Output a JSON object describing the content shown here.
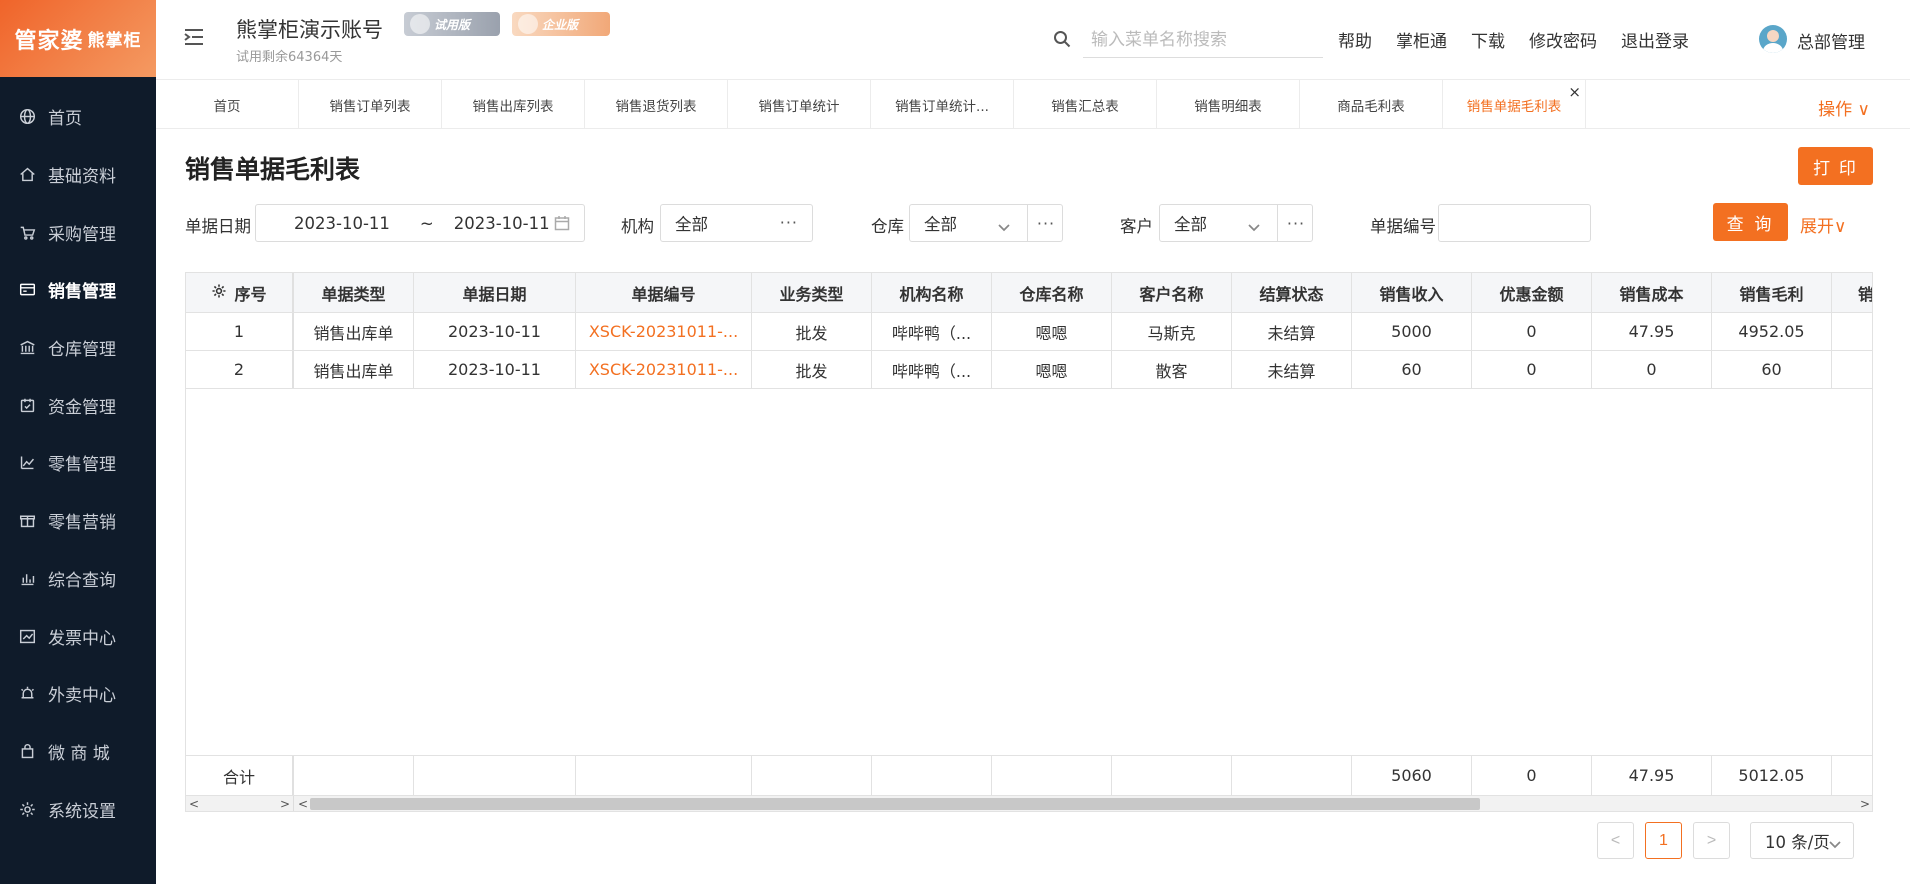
{
  "brand": {
    "logo_main": "管家婆",
    "logo_sub": "熊掌柜"
  },
  "sidebar": {
    "items": [
      {
        "label": "首页",
        "icon": "globe-icon"
      },
      {
        "label": "基础资料",
        "icon": "home-icon"
      },
      {
        "label": "采购管理",
        "icon": "cart-icon"
      },
      {
        "label": "销售管理",
        "icon": "card-icon",
        "active": true
      },
      {
        "label": "仓库管理",
        "icon": "bank-icon"
      },
      {
        "label": "资金管理",
        "icon": "calendar-icon"
      },
      {
        "label": "零售管理",
        "icon": "chart-icon"
      },
      {
        "label": "零售营销",
        "icon": "gift-icon"
      },
      {
        "label": "综合查询",
        "icon": "bar-chart-icon"
      },
      {
        "label": "发票中心",
        "icon": "trend-icon"
      },
      {
        "label": "外卖中心",
        "icon": "alarm-icon"
      },
      {
        "label": "微 商 城",
        "icon": "bag-icon"
      },
      {
        "label": "系统设置",
        "icon": "gear-icon"
      }
    ]
  },
  "header": {
    "account": "熊掌柜演示账号",
    "badge_trial": "试用版",
    "badge_enterprise": "企业版",
    "trial_text": "试用剩余64364天",
    "search_placeholder": "输入菜单名称搜索",
    "links": [
      "帮助",
      "掌柜通",
      "下载",
      "修改密码",
      "退出登录"
    ],
    "user_name": "总部管理"
  },
  "tabs": [
    {
      "label": "首页"
    },
    {
      "label": "销售订单列表"
    },
    {
      "label": "销售出库列表"
    },
    {
      "label": "销售退货列表"
    },
    {
      "label": "销售订单统计"
    },
    {
      "label": "销售订单统计..."
    },
    {
      "label": "销售汇总表"
    },
    {
      "label": "销售明细表"
    },
    {
      "label": "商品毛利表"
    },
    {
      "label": "销售单据毛利表",
      "active": true
    }
  ],
  "tab_ops": "操作 ∨",
  "page": {
    "title": "销售单据毛利表",
    "print_label": "打 印"
  },
  "filters": {
    "date_label": "单据日期",
    "date_from": "2023-10-11",
    "date_sep": "~",
    "date_to": "2023-10-11",
    "org_label": "机构",
    "org_value": "全部",
    "warehouse_label": "仓库",
    "warehouse_value": "全部",
    "customer_label": "客户",
    "customer_value": "全部",
    "doc_no_label": "单据编号",
    "doc_no_value": "",
    "query_label": "查 询",
    "expand_label": "展开∨",
    "dots": "···"
  },
  "table": {
    "columns": [
      "序号",
      "单据类型",
      "单据日期",
      "单据编号",
      "业务类型",
      "机构名称",
      "仓库名称",
      "客户名称",
      "结算状态",
      "销售收入",
      "优惠金额",
      "销售成本",
      "销售毛利",
      "销"
    ],
    "rows": [
      [
        "1",
        "销售出库单",
        "2023-10-11",
        "XSCK-20231011-...",
        "批发",
        "哔哔鸭（...",
        "嗯嗯",
        "马斯克",
        "未结算",
        "5000",
        "0",
        "47.95",
        "4952.05"
      ],
      [
        "2",
        "销售出库单",
        "2023-10-11",
        "XSCK-20231011-...",
        "批发",
        "哔哔鸭（...",
        "嗯嗯",
        "散客",
        "未结算",
        "60",
        "0",
        "0",
        "60"
      ]
    ],
    "footer": [
      "合计",
      "",
      "",
      "",
      "",
      "",
      "",
      "",
      "",
      "5060",
      "0",
      "47.95",
      "5012.05"
    ]
  },
  "pagination": {
    "prev": "<",
    "current": "1",
    "next": ">",
    "page_size": "10 条/页"
  },
  "colors": {
    "accent": "#f37021",
    "sidebar_bg": "#0f1b2a"
  }
}
